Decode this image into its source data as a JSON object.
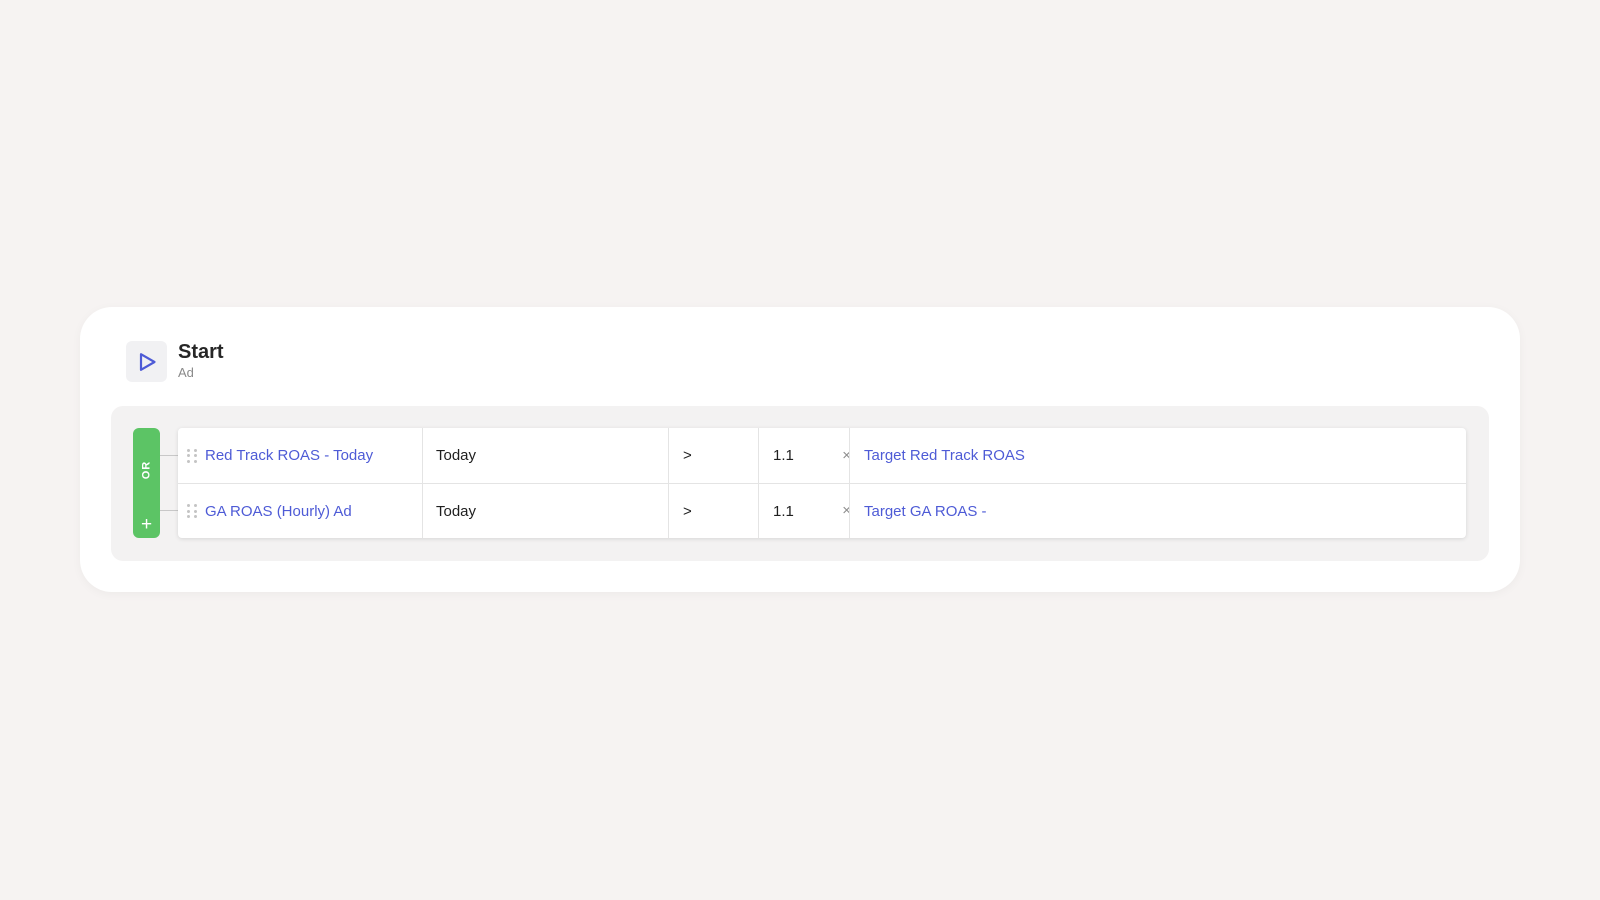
{
  "node": {
    "title": "Start",
    "subtitle": "Ad",
    "icon": "play-icon",
    "accent_color": "#4e5bd6"
  },
  "group": {
    "logic_label": "OR",
    "add_label": "+",
    "color": "#5cc465"
  },
  "conditions": [
    {
      "metric": "Red Track ROAS - Today",
      "period": "Today",
      "operator": ">",
      "value": "1.1",
      "multiplier": "×",
      "target": "Target Red Track ROAS"
    },
    {
      "metric": "GA ROAS (Hourly) Ad",
      "period": "Today",
      "operator": ">",
      "value": "1.1",
      "multiplier": "×",
      "target": "Target GA ROAS -"
    }
  ]
}
